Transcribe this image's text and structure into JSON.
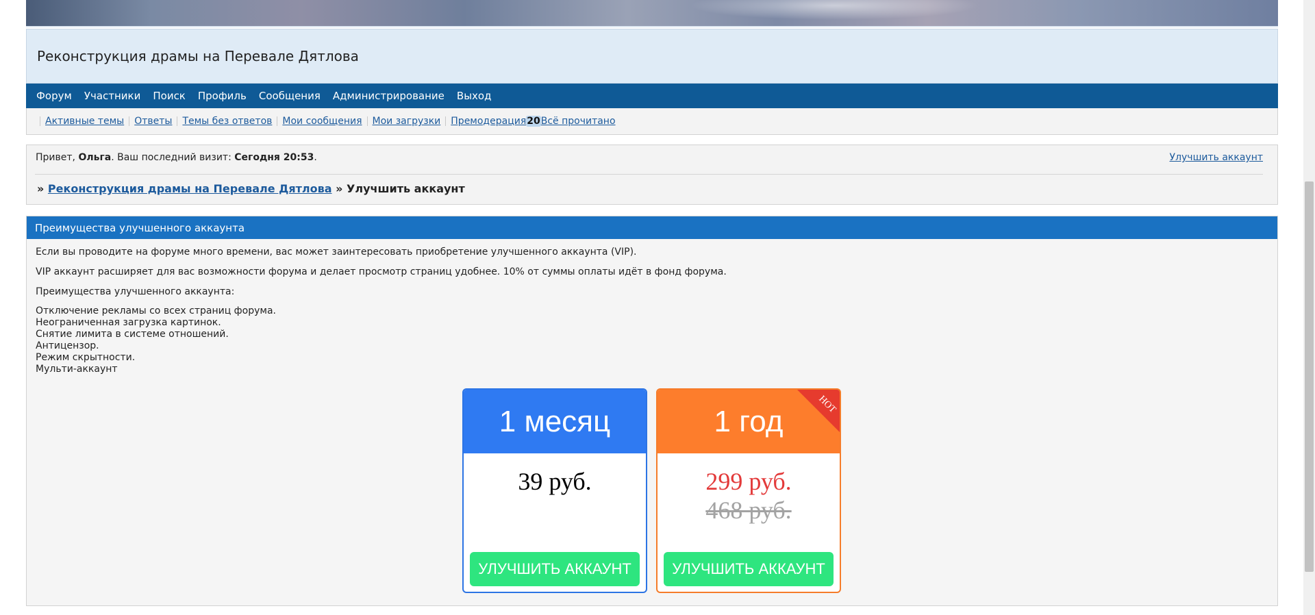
{
  "site": {
    "title": "Реконструкция драмы на Перевале Дятлова"
  },
  "mainnav": [
    "Форум",
    "Участники",
    "Поиск",
    "Профиль",
    "Сообщения",
    "Администрирование",
    "Выход"
  ],
  "subnav": {
    "active_topics": "Активные темы",
    "replies": "Ответы",
    "unanswered": "Темы без ответов",
    "my_posts": "Мои сообщения",
    "my_uploads": "Мои загрузки",
    "premoderation": "Премодерация",
    "premoderation_count": "20",
    "mark_read": "Всё прочитано"
  },
  "welcome": {
    "greeting": "Привет, ",
    "username": "Ольга",
    "after_name": ".  Ваш последний визит: ",
    "last_visit": "Сегодня 20:53",
    "end": ".",
    "upgrade_link": "Улучшить аккаунт"
  },
  "breadcrumb": {
    "sep1": "» ",
    "forum": "Реконструкция драмы на Перевале Дятлова",
    "sep2": " » ",
    "current": "Улучшить аккаунт"
  },
  "panel": {
    "title": "Преимущества улучшенного аккаунта",
    "p1": "Если вы проводите на форуме много времени, вас может заинтересовать приобретение улучшенного аккаунта (VIP).",
    "p2": "VIP аккаунт расширяет для вас возможности форума и делает просмотр страниц удобнее. 10% от суммы оплаты идёт в фонд форума.",
    "p3": "Преимущества улучшенного аккаунта:",
    "features": [
      "Отключение рекламы со всех страниц форума.",
      "Неограниченная загрузка картинок.",
      "Снятие лимита в системе отношений.",
      "Антицензор.",
      "Режим скрытности.",
      "Мульти-аккаунт"
    ]
  },
  "plans": {
    "month": {
      "title": "1 месяц",
      "price": "39 руб.",
      "button": "УЛУЧШИТЬ АККАУНТ"
    },
    "year": {
      "title": "1 год",
      "price": "299 руб.",
      "old_price": "468 руб.",
      "button": "УЛУЧШИТЬ АККАУНТ",
      "ribbon": "HOT"
    }
  },
  "colors": {
    "nav_bg": "#0f5a96",
    "panel_head": "#1a72c2",
    "month_accent": "#2f7af2",
    "year_accent": "#fd7d2c",
    "button": "#2ee57f",
    "sale_price": "#e33a3a"
  }
}
